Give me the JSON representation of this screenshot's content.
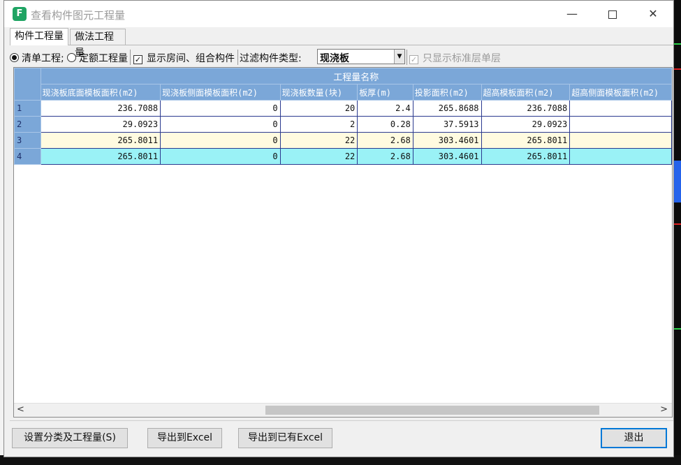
{
  "window": {
    "title": "查看构件图元工程量"
  },
  "tabs": [
    {
      "label": "构件工程量"
    },
    {
      "label": "做法工程量"
    }
  ],
  "options": {
    "radio_list": "清单工程",
    "radio_quota": "定额工程量",
    "checkbox_show_rooms": "显示房间、组合构件",
    "filter_label": "过滤构件类型:",
    "filter_value": "现浇板",
    "checkbox_std_floor": "只显示标准层单层"
  },
  "table": {
    "group_header": "工程量名称",
    "columns": [
      "现浇板底面模板面积(m2)",
      "现浇板侧面模板面积(m2)",
      "现浇板数量(块)",
      "板厚(m)",
      "投影面积(m2)",
      "超高模板面积(m2)",
      "超高侧面模板面积(m2)"
    ],
    "rows": [
      {
        "num": "1",
        "cells": [
          "236.7088",
          "0",
          "20",
          "2.4",
          "265.8688",
          "236.7088",
          ""
        ]
      },
      {
        "num": "2",
        "cells": [
          "29.0923",
          "0",
          "2",
          "0.28",
          "37.5913",
          "29.0923",
          ""
        ]
      },
      {
        "num": "3",
        "cells": [
          "265.8011",
          "0",
          "22",
          "2.68",
          "303.4601",
          "265.8011",
          ""
        ]
      },
      {
        "num": "4",
        "cells": [
          "265.8011",
          "0",
          "22",
          "2.68",
          "303.4601",
          "265.8011",
          ""
        ]
      }
    ]
  },
  "buttons": {
    "settings": "设置分类及工程量(S)",
    "export_excel": "导出到Excel",
    "export_existing": "导出到已有Excel",
    "exit": "退出"
  },
  "colors": {
    "header_blue": "#7ba7d8",
    "row_cream": "#fffbe0",
    "row_cyan": "#9af2f6",
    "app_icon_green": "#1fa463"
  },
  "icons": {
    "app": "app-logo-icon",
    "minimize": "minimize-icon",
    "maximize": "maximize-icon",
    "close": "close-icon"
  }
}
